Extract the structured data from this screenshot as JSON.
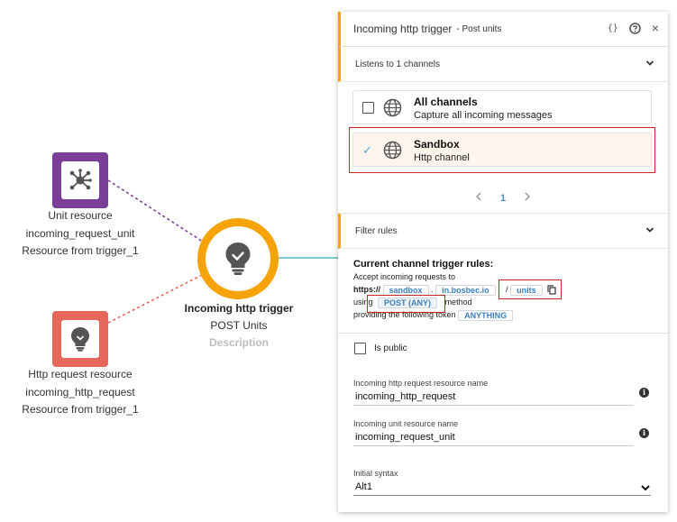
{
  "canvas": {
    "unit_node": {
      "icon": "hub-network-icon",
      "line1": "Unit resource",
      "line2": "incoming_request_unit",
      "line3": "Resource from trigger_1",
      "color": "#7B3F99"
    },
    "http_node": {
      "icon": "lightbulb-icon",
      "line1": "Http request resource",
      "line2": "incoming_http_request",
      "line3": "Resource from trigger_1",
      "color": "#E5675C"
    },
    "trigger_node": {
      "icon": "lightbulb-check-icon",
      "title": "Incoming http trigger",
      "subtitle": "POST Units",
      "description": "Description",
      "color": "#F5A306"
    }
  },
  "panel": {
    "title": "Incoming http trigger",
    "subtitle": "- Post units",
    "icons": [
      "json-braces-icon",
      "help-icon",
      "close-icon"
    ],
    "icon_labels": {
      "json": "{}",
      "close": "×"
    },
    "channels_section": "Listens to 1 channels",
    "channels": [
      {
        "name": "All channels",
        "description": "Capture all incoming messages",
        "selected": false
      },
      {
        "name": "Sandbox",
        "description": "Http channel",
        "selected": true
      }
    ],
    "pagination": {
      "current": "1"
    },
    "filter_section": "Filter rules",
    "rules": {
      "heading": "Current channel trigger rules:",
      "accept_text": "Accept incoming requests to",
      "scheme": "https://",
      "subdomain": "sandbox",
      "dot": ".",
      "domain": "in.bosbec.io",
      "slash": "/",
      "path": "units",
      "using_text": "using",
      "method": "POST (ANY)",
      "method_text": "method",
      "token_text": "providing the following token",
      "token": "ANYTHING"
    },
    "is_public_label": "Is public",
    "fields": {
      "http_name_label": "Incoming http request resource name",
      "http_name_value": "incoming_http_request",
      "unit_name_label": "Incoming unit resource name",
      "unit_name_value": "incoming_request_unit",
      "syntax_label": "Initial syntax",
      "syntax_value": "Alt1"
    }
  },
  "colors": {
    "accent": "#F5A306",
    "highlight_border": "#C62828",
    "link": "#3C7FC0",
    "selected_bg": "#FDF4EC"
  }
}
